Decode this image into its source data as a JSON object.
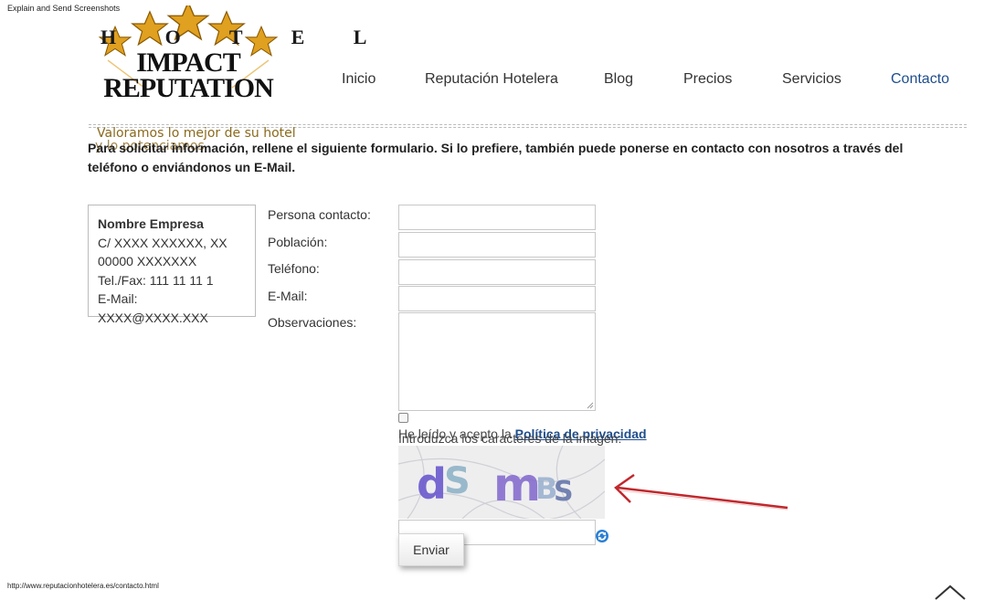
{
  "top_caption": "Explain and Send Screenshots",
  "status_url": "http://www.reputacionhotelera.es/contacto.html",
  "logo": {
    "line1": "H O T E L",
    "line2": "IMPACT",
    "line3": "REPUTATION",
    "star_color": "#e0a020"
  },
  "nav": {
    "items": [
      {
        "label": "Inicio"
      },
      {
        "label": "Reputación Hotelera"
      },
      {
        "label": "Blog"
      },
      {
        "label": "Precios"
      },
      {
        "label": "Servicios"
      },
      {
        "label": "Contacto",
        "active": true
      }
    ],
    "active_color": "#1f4e8c"
  },
  "tagline": "Valoramos lo mejor de su hotel",
  "tagline2": "y lo potenciamos",
  "intro": "Para solicitar información, rellene el siguiente formulario. Si lo prefiere, también puede ponerse en contacto con nosotros  a través del teléfono o enviándonos un E-Mail.",
  "address": {
    "name": "Nombre Empresa",
    "street": "C/ XXXX XXXXXX, XX",
    "city": "00000 XXXXXXX",
    "phone": "Tel./Fax: 111 11 11 1",
    "email": "E-Mail: XXXX@XXXX.XXX"
  },
  "form": {
    "contact_label": "Persona contacto:",
    "city_label": "Población:",
    "phone_label": "Teléfono:",
    "email_label": "E-Mail:",
    "notes_label": "Observaciones:",
    "contact_value": "",
    "city_value": "",
    "phone_value": "",
    "email_value": "",
    "notes_value": "",
    "consent_prefix": "He leído y acepto la ",
    "consent_link": "Política de privacidad",
    "captcha_label": "Introduzca los caracteres de la imagen:",
    "captcha_value": "",
    "submit_label": "Enviar"
  },
  "icons": {
    "refresh": "refresh-icon",
    "scroll_top": "chevron-up-icon",
    "annotation_arrow": "arrow-left-icon"
  },
  "colors": {
    "link": "#1f4e8c",
    "tagline": "#8b6a1d",
    "arrow": "#c0282d"
  }
}
